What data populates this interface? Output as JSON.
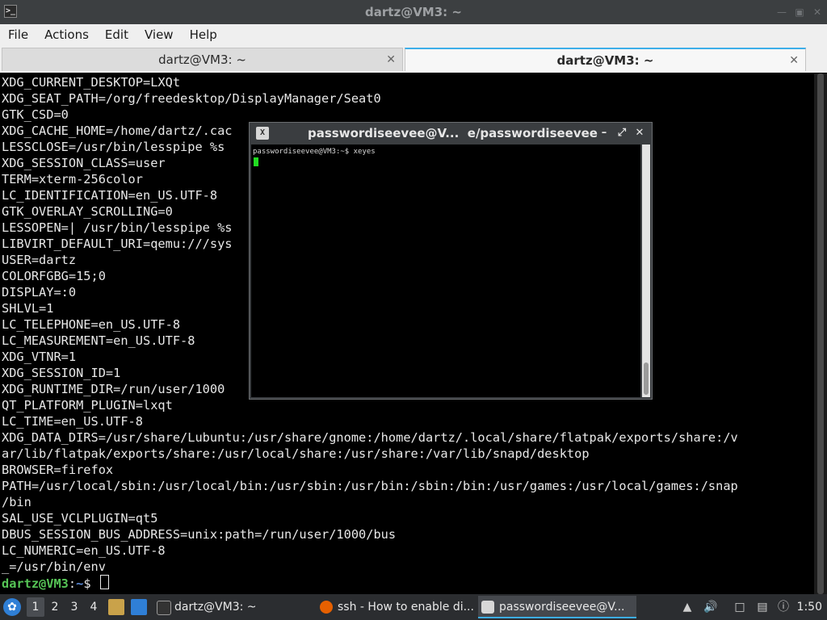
{
  "window": {
    "title": "dartz@VM3: ~",
    "app_icon": "terminal-icon",
    "controls": [
      "minimize-icon",
      "maximize-icon",
      "close-icon"
    ]
  },
  "menubar": [
    "File",
    "Actions",
    "Edit",
    "View",
    "Help"
  ],
  "tabs": [
    {
      "label": "dartz@VM3: ~",
      "active": false
    },
    {
      "label": "dartz@VM3: ~",
      "active": true
    }
  ],
  "terminal": {
    "lines": [
      "XDG_CURRENT_DESKTOP=LXQt",
      "XDG_SEAT_PATH=/org/freedesktop/DisplayManager/Seat0",
      "GTK_CSD=0",
      "XDG_CACHE_HOME=/home/dartz/.cac",
      "LESSCLOSE=/usr/bin/lesspipe %s",
      "XDG_SESSION_CLASS=user",
      "TERM=xterm-256color",
      "LC_IDENTIFICATION=en_US.UTF-8",
      "GTK_OVERLAY_SCROLLING=0",
      "LESSOPEN=| /usr/bin/lesspipe %s",
      "LIBVIRT_DEFAULT_URI=qemu:///sys",
      "USER=dartz",
      "COLORFGBG=15;0",
      "DISPLAY=:0",
      "SHLVL=1",
      "LC_TELEPHONE=en_US.UTF-8",
      "LC_MEASUREMENT=en_US.UTF-8",
      "XDG_VTNR=1",
      "XDG_SESSION_ID=1",
      "XDG_RUNTIME_DIR=/run/user/1000",
      "QT_PLATFORM_PLUGIN=lxqt",
      "LC_TIME=en_US.UTF-8",
      "XDG_DATA_DIRS=/usr/share/Lubuntu:/usr/share/gnome:/home/dartz/.local/share/flatpak/exports/share:/v",
      "ar/lib/flatpak/exports/share:/usr/local/share:/usr/share:/var/lib/snapd/desktop",
      "BROWSER=firefox",
      "PATH=/usr/local/sbin:/usr/local/bin:/usr/sbin:/usr/bin:/sbin:/bin:/usr/games:/usr/local/games:/snap",
      "/bin",
      "SAL_USE_VCLPLUGIN=qt5",
      "DBUS_SESSION_BUS_ADDRESS=unix:path=/run/user/1000/bus",
      "LC_NUMERIC=en_US.UTF-8",
      "_=/usr/bin/env"
    ],
    "prompt": {
      "user_host": "dartz@VM3",
      "sep": ":",
      "path": "~",
      "symbol": "$ "
    }
  },
  "xterm": {
    "title": "passwordiseevee@V...  e/passwordiseevee",
    "line": "passwordiseevee@VM3:~$ xeyes",
    "controls": [
      "minimize-icon",
      "maximize-icon",
      "close-icon"
    ]
  },
  "taskbar": {
    "desktops": [
      "1",
      "2",
      "3",
      "4"
    ],
    "tasks": [
      {
        "label": "dartz@VM3: ~",
        "icon": "terminal-icon"
      },
      {
        "label": "ssh - How to enable di...",
        "icon": "firefox-icon"
      },
      {
        "label": "passwordiseevee@V...",
        "icon": "xterm-icon"
      }
    ],
    "clock": "1:50"
  },
  "colors": {
    "accent": "#3daee9",
    "prompt_user": "#56c556",
    "prompt_path": "#5b8bd9",
    "cursor_green": "#22dd22"
  }
}
